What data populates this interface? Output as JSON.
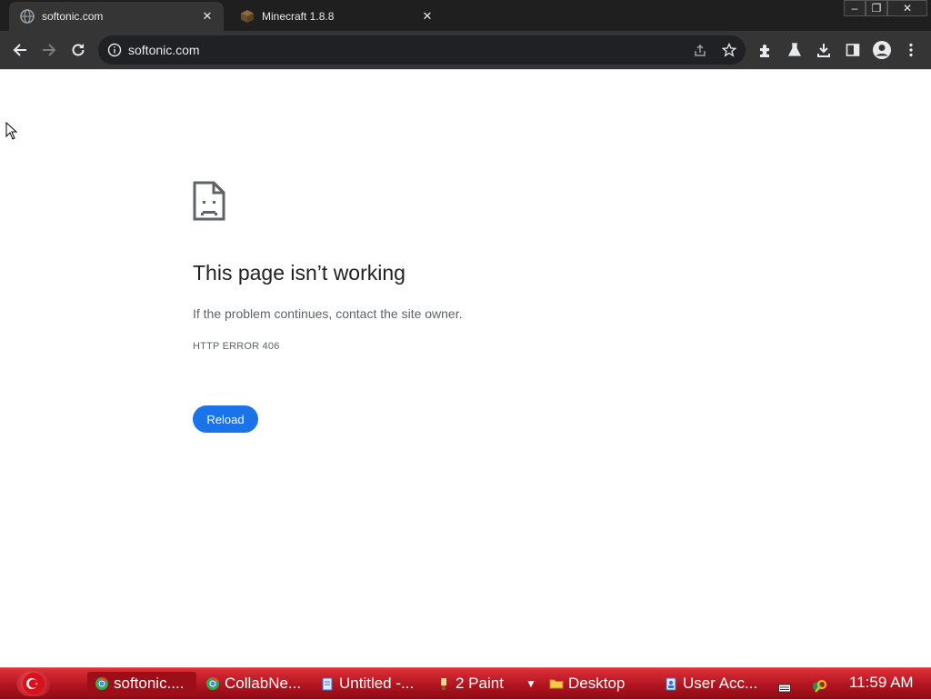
{
  "browser": {
    "tabs": [
      {
        "title": "softonic.com",
        "active": true
      },
      {
        "title": "Minecraft 1.8.8",
        "active": false
      }
    ],
    "tab_close_glyph": "✕",
    "window_controls": {
      "minimize": "–",
      "restore": "❐",
      "close": "✕"
    },
    "address_bar": {
      "url": "softonic.com"
    }
  },
  "error_page": {
    "heading": "This page isn’t working",
    "message": "If the problem continues, contact the site owner.",
    "error_code": "HTTP ERROR 406",
    "reload_label": "Reload",
    "accent_color": "#1a73e8"
  },
  "taskbar": {
    "items": [
      {
        "label": "softonic....",
        "icon": "chrome-icon",
        "active": true
      },
      {
        "label": "CollabNe...",
        "icon": "chrome-icon",
        "active": false
      },
      {
        "label": "Untitled -...",
        "icon": "notepad-icon",
        "active": false
      },
      {
        "label": "2 Paint",
        "icon": "paint-icon",
        "active": false
      },
      {
        "label": "Desktop",
        "icon": "folder-icon",
        "active": false
      },
      {
        "label": "User Acc...",
        "icon": "user-accounts-icon",
        "active": false
      }
    ],
    "clock": "11:59 AM",
    "color": "#c0141f"
  }
}
